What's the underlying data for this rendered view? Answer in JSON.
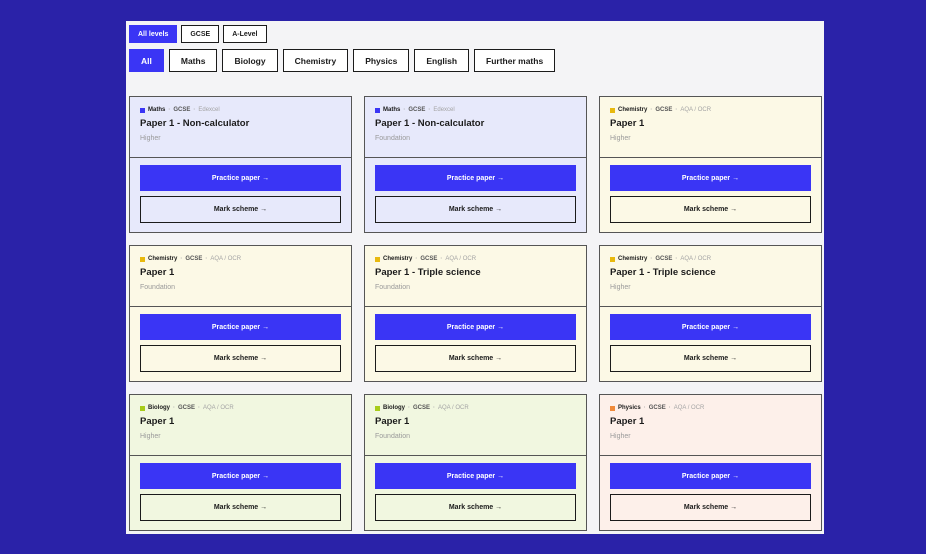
{
  "filters": {
    "levels": [
      "All levels",
      "GCSE",
      "A-Level"
    ],
    "active_level": 0,
    "subjects": [
      "All",
      "Maths",
      "Biology",
      "Chemistry",
      "Physics",
      "English",
      "Further maths"
    ],
    "active_subject": 0
  },
  "colors": {
    "accent": "#3a35f5",
    "maths": "#3a35f5",
    "chemistry": "#e8b90e",
    "biology": "#a8cc1a",
    "physics": "#f08a3a",
    "maths_bg": "#e7e9fb",
    "chemistry_bg": "#fcf9e6",
    "biology_bg": "#f1f7e0",
    "physics_bg": "#fdf0ea"
  },
  "cards": [
    {
      "subject": "Maths",
      "level": "GCSE",
      "board": "Edexcel",
      "title": "Paper 1 - Non-calculator",
      "tier": "Higher",
      "color": "maths",
      "practice": "Practice paper →",
      "mark": "Mark scheme →"
    },
    {
      "subject": "Maths",
      "level": "GCSE",
      "board": "Edexcel",
      "title": "Paper 1 - Non-calculator",
      "tier": "Foundation",
      "color": "maths",
      "practice": "Practice paper →",
      "mark": "Mark scheme →"
    },
    {
      "subject": "Chemistry",
      "level": "GCSE",
      "board": "AQA / OCR",
      "title": "Paper 1",
      "tier": "Higher",
      "color": "chemistry",
      "practice": "Practice paper →",
      "mark": "Mark scheme →"
    },
    {
      "subject": "Chemistry",
      "level": "GCSE",
      "board": "AQA / OCR",
      "title": "Paper 1",
      "tier": "Foundation",
      "color": "chemistry",
      "practice": "Practice paper →",
      "mark": "Mark scheme →"
    },
    {
      "subject": "Chemistry",
      "level": "GCSE",
      "board": "AQA / OCR",
      "title": "Paper 1 - Triple science",
      "tier": "Foundation",
      "color": "chemistry",
      "practice": "Practice paper →",
      "mark": "Mark scheme →"
    },
    {
      "subject": "Chemistry",
      "level": "GCSE",
      "board": "AQA / OCR",
      "title": "Paper 1 - Triple science",
      "tier": "Higher",
      "color": "chemistry",
      "practice": "Practice paper →",
      "mark": "Mark scheme →"
    },
    {
      "subject": "Biology",
      "level": "GCSE",
      "board": "AQA / OCR",
      "title": "Paper 1",
      "tier": "Higher",
      "color": "biology",
      "practice": "Practice paper →",
      "mark": "Mark scheme →"
    },
    {
      "subject": "Biology",
      "level": "GCSE",
      "board": "AQA / OCR",
      "title": "Paper 1",
      "tier": "Foundation",
      "color": "biology",
      "practice": "Practice paper →",
      "mark": "Mark scheme →"
    },
    {
      "subject": "Physics",
      "level": "GCSE",
      "board": "AQA / OCR",
      "title": "Paper 1",
      "tier": "Higher",
      "color": "physics",
      "practice": "Practice paper →",
      "mark": "Mark scheme →"
    }
  ]
}
